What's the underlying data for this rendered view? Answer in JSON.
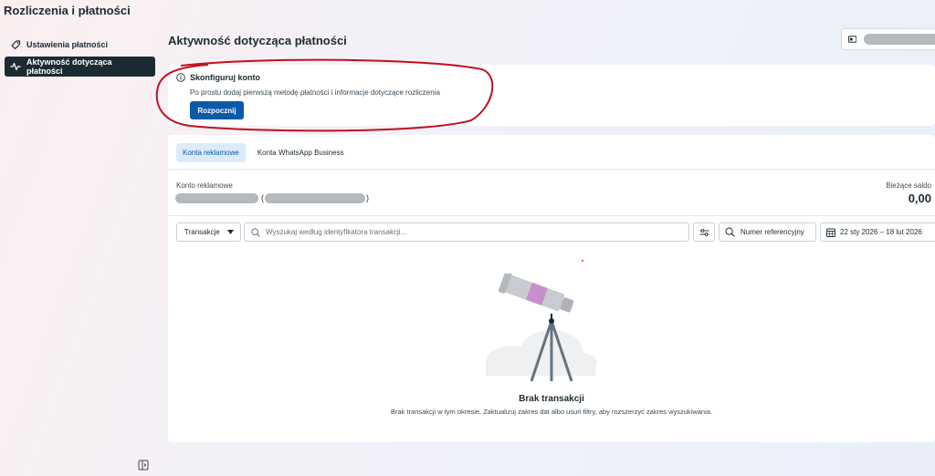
{
  "app": {
    "title": "Rozliczenia i płatności"
  },
  "sidebar": {
    "items": [
      {
        "label": "Ustawienia płatności",
        "icon": "tag-icon"
      },
      {
        "label": "Aktywność dotycząca płatności",
        "icon": "activity-icon",
        "active": true
      }
    ],
    "collapse_icon": "sidebar-toggle-icon"
  },
  "header": {
    "page_title": "Aktywność dotycząca płatności"
  },
  "setup": {
    "title": "Skonfiguruj konto",
    "description": "Po prostu dodaj pierwszą metodę płatności i informacje dotyczące rozliczenia",
    "button": "Rozpocznij"
  },
  "tabs": [
    {
      "label": "Konta reklamowe",
      "active": true
    },
    {
      "label": "Konta WhatsApp Business",
      "active": false
    }
  ],
  "account": {
    "label": "Konto reklamowe",
    "open_paren": "(",
    "close_paren": ")",
    "balance_label": "Bieżące saldo",
    "balance_value": "0,00"
  },
  "filters": {
    "type_dropdown": "Transakcje",
    "search_placeholder": "Wyszukaj według identyfikatora transakcji...",
    "reference_button": "Numer referencyjny",
    "date_range": "22 sty 2026 – 18 lut 2026"
  },
  "empty_state": {
    "title": "Brak transakcji",
    "description": "Brak transakcji w tym okresie. Zaktualizuj zakres dat albo usuń filtry, aby rozszerzyć zakres wyszukiwania."
  },
  "colors": {
    "primary": "#0a5aa8",
    "nav_active": "#1c2b33",
    "annotation": "#c0111f"
  }
}
